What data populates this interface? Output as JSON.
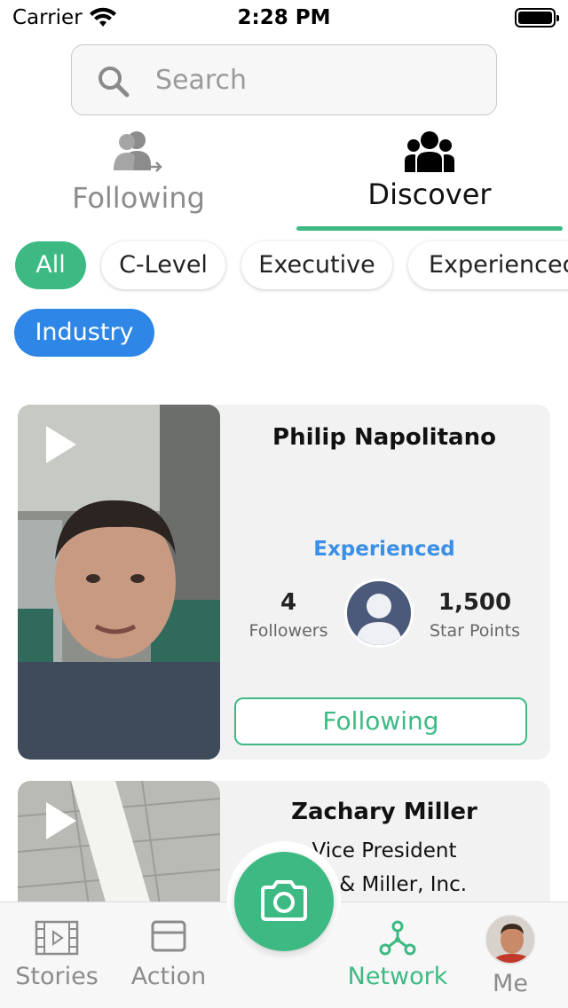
{
  "status_bar": {
    "carrier": "Carrier",
    "time": "2:28 PM"
  },
  "search": {
    "placeholder": "Search"
  },
  "tabs": [
    {
      "label": "Following",
      "icon": "following-users-icon",
      "active": false
    },
    {
      "label": "Discover",
      "icon": "group-icon",
      "active": true
    }
  ],
  "filters": [
    {
      "label": "All",
      "active": true
    },
    {
      "label": "C-Level",
      "active": false
    },
    {
      "label": "Executive",
      "active": false
    },
    {
      "label": "Experienced",
      "active": false
    }
  ],
  "industry_chip": {
    "label": "Industry"
  },
  "cards": [
    {
      "name": "Philip Napolitano",
      "level": "Experienced",
      "followers": "4",
      "followers_label": "Followers",
      "star_points": "1,500",
      "star_points_label": "Star Points",
      "button_label": "Following"
    },
    {
      "name": "Zachary Miller",
      "title": "Vice President",
      "company": "lap & Miller, Inc."
    }
  ],
  "tabbar": {
    "items": [
      {
        "label": "Stories",
        "icon": "film-icon",
        "active": false
      },
      {
        "label": "Action",
        "icon": "window-icon",
        "active": false
      },
      {
        "label": "Network",
        "icon": "network-icon",
        "active": true
      },
      {
        "label": "Me",
        "icon": "avatar-icon",
        "active": false
      }
    ],
    "camera_icon": "camera-icon"
  },
  "colors": {
    "accent": "#3dba83",
    "blue": "#2e86e6",
    "level": "#3a8fe6"
  }
}
